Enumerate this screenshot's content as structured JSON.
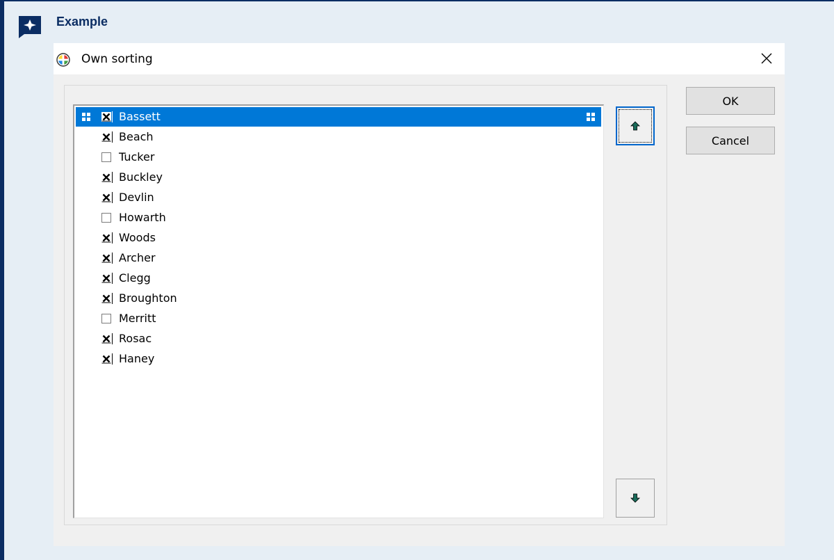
{
  "callout": {
    "title": "Example"
  },
  "dialog": {
    "title": "Own sorting",
    "ok_label": "OK",
    "cancel_label": "Cancel"
  },
  "items": [
    {
      "label": "Bassett",
      "checked": true,
      "selected": true
    },
    {
      "label": "Beach",
      "checked": true,
      "selected": false
    },
    {
      "label": "Tucker",
      "checked": false,
      "selected": false
    },
    {
      "label": "Buckley",
      "checked": true,
      "selected": false
    },
    {
      "label": "Devlin",
      "checked": true,
      "selected": false
    },
    {
      "label": "Howarth",
      "checked": false,
      "selected": false
    },
    {
      "label": "Woods",
      "checked": true,
      "selected": false
    },
    {
      "label": "Archer",
      "checked": true,
      "selected": false
    },
    {
      "label": "Clegg",
      "checked": true,
      "selected": false
    },
    {
      "label": "Broughton",
      "checked": true,
      "selected": false
    },
    {
      "label": "Merritt",
      "checked": false,
      "selected": false
    },
    {
      "label": "Rosac",
      "checked": true,
      "selected": false
    },
    {
      "label": "Haney",
      "checked": true,
      "selected": false
    }
  ],
  "colors": {
    "callout_border": "#0b2d63",
    "callout_bg": "#e6eef5",
    "selection": "#0078d7",
    "arrow": "#1a6b5a"
  },
  "icons": {
    "callout": "sparkle-icon",
    "app": "color-circle-icon",
    "close": "close-icon",
    "up": "arrow-up-icon",
    "down": "arrow-down-icon"
  }
}
